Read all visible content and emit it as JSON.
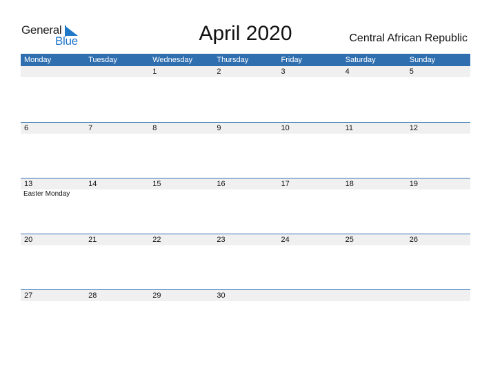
{
  "logo": {
    "general": "General",
    "blue": "Blue"
  },
  "title": "April 2020",
  "country": "Central African Republic",
  "weekdays": [
    "Monday",
    "Tuesday",
    "Wednesday",
    "Thursday",
    "Friday",
    "Saturday",
    "Sunday"
  ],
  "weeks": [
    {
      "days": [
        "",
        "",
        "1",
        "2",
        "3",
        "4",
        "5"
      ],
      "events": [
        "",
        "",
        "",
        "",
        "",
        "",
        ""
      ]
    },
    {
      "days": [
        "6",
        "7",
        "8",
        "9",
        "10",
        "11",
        "12"
      ],
      "events": [
        "",
        "",
        "",
        "",
        "",
        "",
        ""
      ]
    },
    {
      "days": [
        "13",
        "14",
        "15",
        "16",
        "17",
        "18",
        "19"
      ],
      "events": [
        "Easter Monday",
        "",
        "",
        "",
        "",
        "",
        ""
      ]
    },
    {
      "days": [
        "20",
        "21",
        "22",
        "23",
        "24",
        "25",
        "26"
      ],
      "events": [
        "",
        "",
        "",
        "",
        "",
        "",
        ""
      ]
    },
    {
      "days": [
        "27",
        "28",
        "29",
        "30",
        "",
        "",
        ""
      ],
      "events": [
        "",
        "",
        "",
        "",
        "",
        "",
        ""
      ]
    }
  ],
  "colors": {
    "header_bg": "#2f6fb0",
    "brand_blue": "#1f77c8",
    "day_row_bg": "#f0f0f0"
  }
}
